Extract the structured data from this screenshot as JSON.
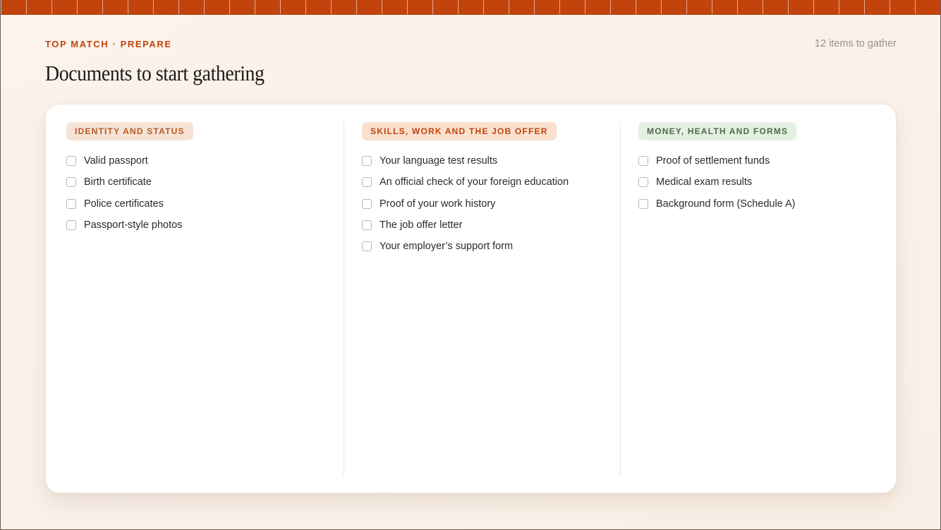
{
  "header": {
    "eyebrow": "TOP MATCH · PREPARE",
    "title": "Documents to start gathering",
    "item_count": "12 items to gather"
  },
  "colors": {
    "accent": "#c2440c",
    "tag_identity_bg": "#f6e3d6",
    "tag_skills_bg": "#f9e0cf",
    "tag_money_bg": "#e4f0e1",
    "tag_money_text": "#4e6b4c"
  },
  "columns": [
    {
      "tag": "IDENTITY AND STATUS",
      "items": [
        {
          "label": "Valid passport",
          "checked": false
        },
        {
          "label": "Birth certificate",
          "checked": false
        },
        {
          "label": "Police certificates",
          "checked": false
        },
        {
          "label": "Passport-style photos",
          "checked": false
        }
      ]
    },
    {
      "tag": "SKILLS, WORK AND THE JOB OFFER",
      "items": [
        {
          "label": "Your language test results",
          "checked": false
        },
        {
          "label": "An official check of your foreign education",
          "checked": false
        },
        {
          "label": "Proof of your work history",
          "checked": false
        },
        {
          "label": "The job offer letter",
          "checked": false
        },
        {
          "label": "Your employer’s support form",
          "checked": false
        }
      ]
    },
    {
      "tag": "MONEY, HEALTH AND FORMS",
      "items": [
        {
          "label": "Proof of settlement funds",
          "checked": false
        },
        {
          "label": "Medical exam results",
          "checked": false
        },
        {
          "label": "Background form (Schedule A)",
          "checked": false
        }
      ]
    }
  ]
}
